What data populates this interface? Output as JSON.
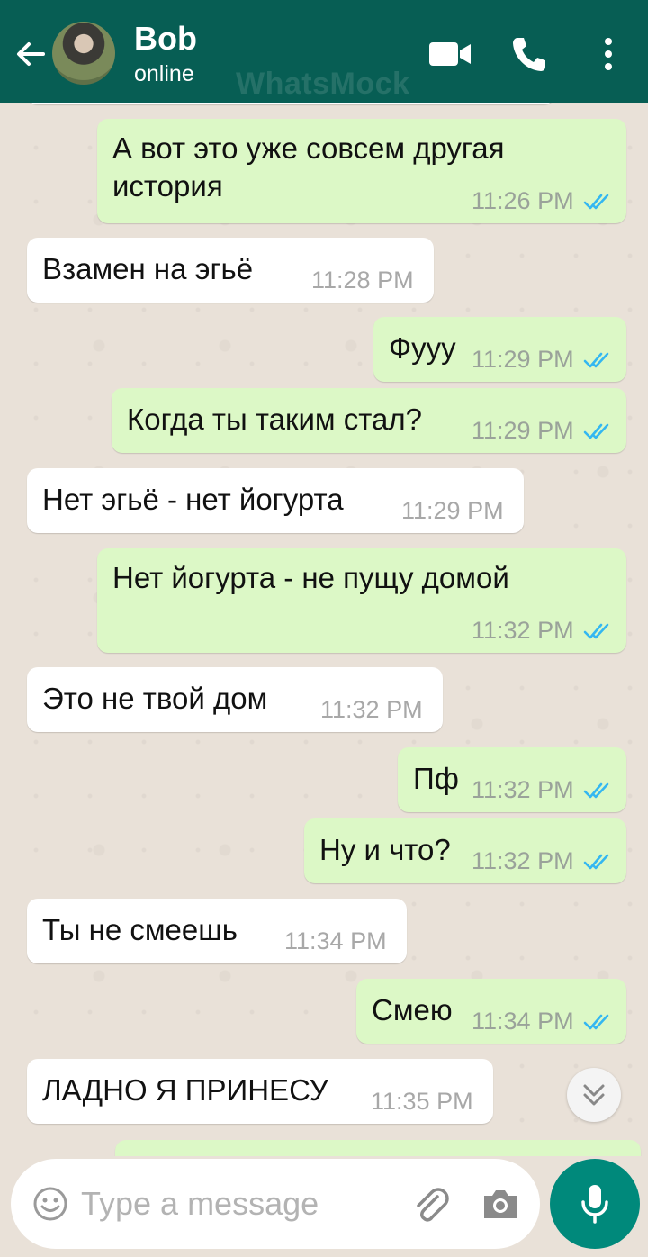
{
  "header": {
    "contact_name": "Bob",
    "contact_status": "online",
    "watermark": "WhatsMock"
  },
  "messages": [
    {
      "direction": "out",
      "text": "А вот это уже совсем другая\nистория",
      "time": "11:26 PM",
      "read": true
    },
    {
      "direction": "in",
      "text": "Взамен на эгьё",
      "time": "11:28 PM"
    },
    {
      "direction": "out",
      "text": "Фууу",
      "time": "11:29 PM",
      "read": true
    },
    {
      "direction": "out",
      "text": "Когда ты таким стал?",
      "time": "11:29 PM",
      "read": true
    },
    {
      "direction": "in",
      "text": "Нет эгьё - нет йогурта",
      "time": "11:29 PM"
    },
    {
      "direction": "out",
      "text": "Нет йогурта - не пущу домой",
      "time": "11:32 PM",
      "read": true
    },
    {
      "direction": "in",
      "text": "Это не твой дом",
      "time": "11:32 PM"
    },
    {
      "direction": "out",
      "text": "Пф",
      "time": "11:32 PM",
      "read": true
    },
    {
      "direction": "out",
      "text": "Ну и что?",
      "time": "11:32 PM",
      "read": true
    },
    {
      "direction": "in",
      "text": "Ты не смеешь",
      "time": "11:34 PM"
    },
    {
      "direction": "out",
      "text": "Смею",
      "time": "11:34 PM",
      "read": true
    },
    {
      "direction": "in",
      "text": "ЛАДНО Я ПРИНЕСУ",
      "time": "11:35 PM"
    }
  ],
  "composer": {
    "placeholder": "Type a message"
  },
  "colors": {
    "header_bg": "#075e54",
    "outgoing_bubble": "#dcf8c6",
    "incoming_bubble": "#ffffff",
    "read_ticks": "#34b7f1",
    "mic_button": "#00897b"
  },
  "icons": {
    "back": "arrow-left-icon",
    "video": "video-camera-icon",
    "call": "phone-icon",
    "menu": "more-vertical-icon",
    "emoji": "emoji-icon",
    "attach": "paperclip-icon",
    "camera": "camera-icon",
    "mic": "microphone-icon",
    "scroll_down": "double-chevron-down-icon"
  }
}
